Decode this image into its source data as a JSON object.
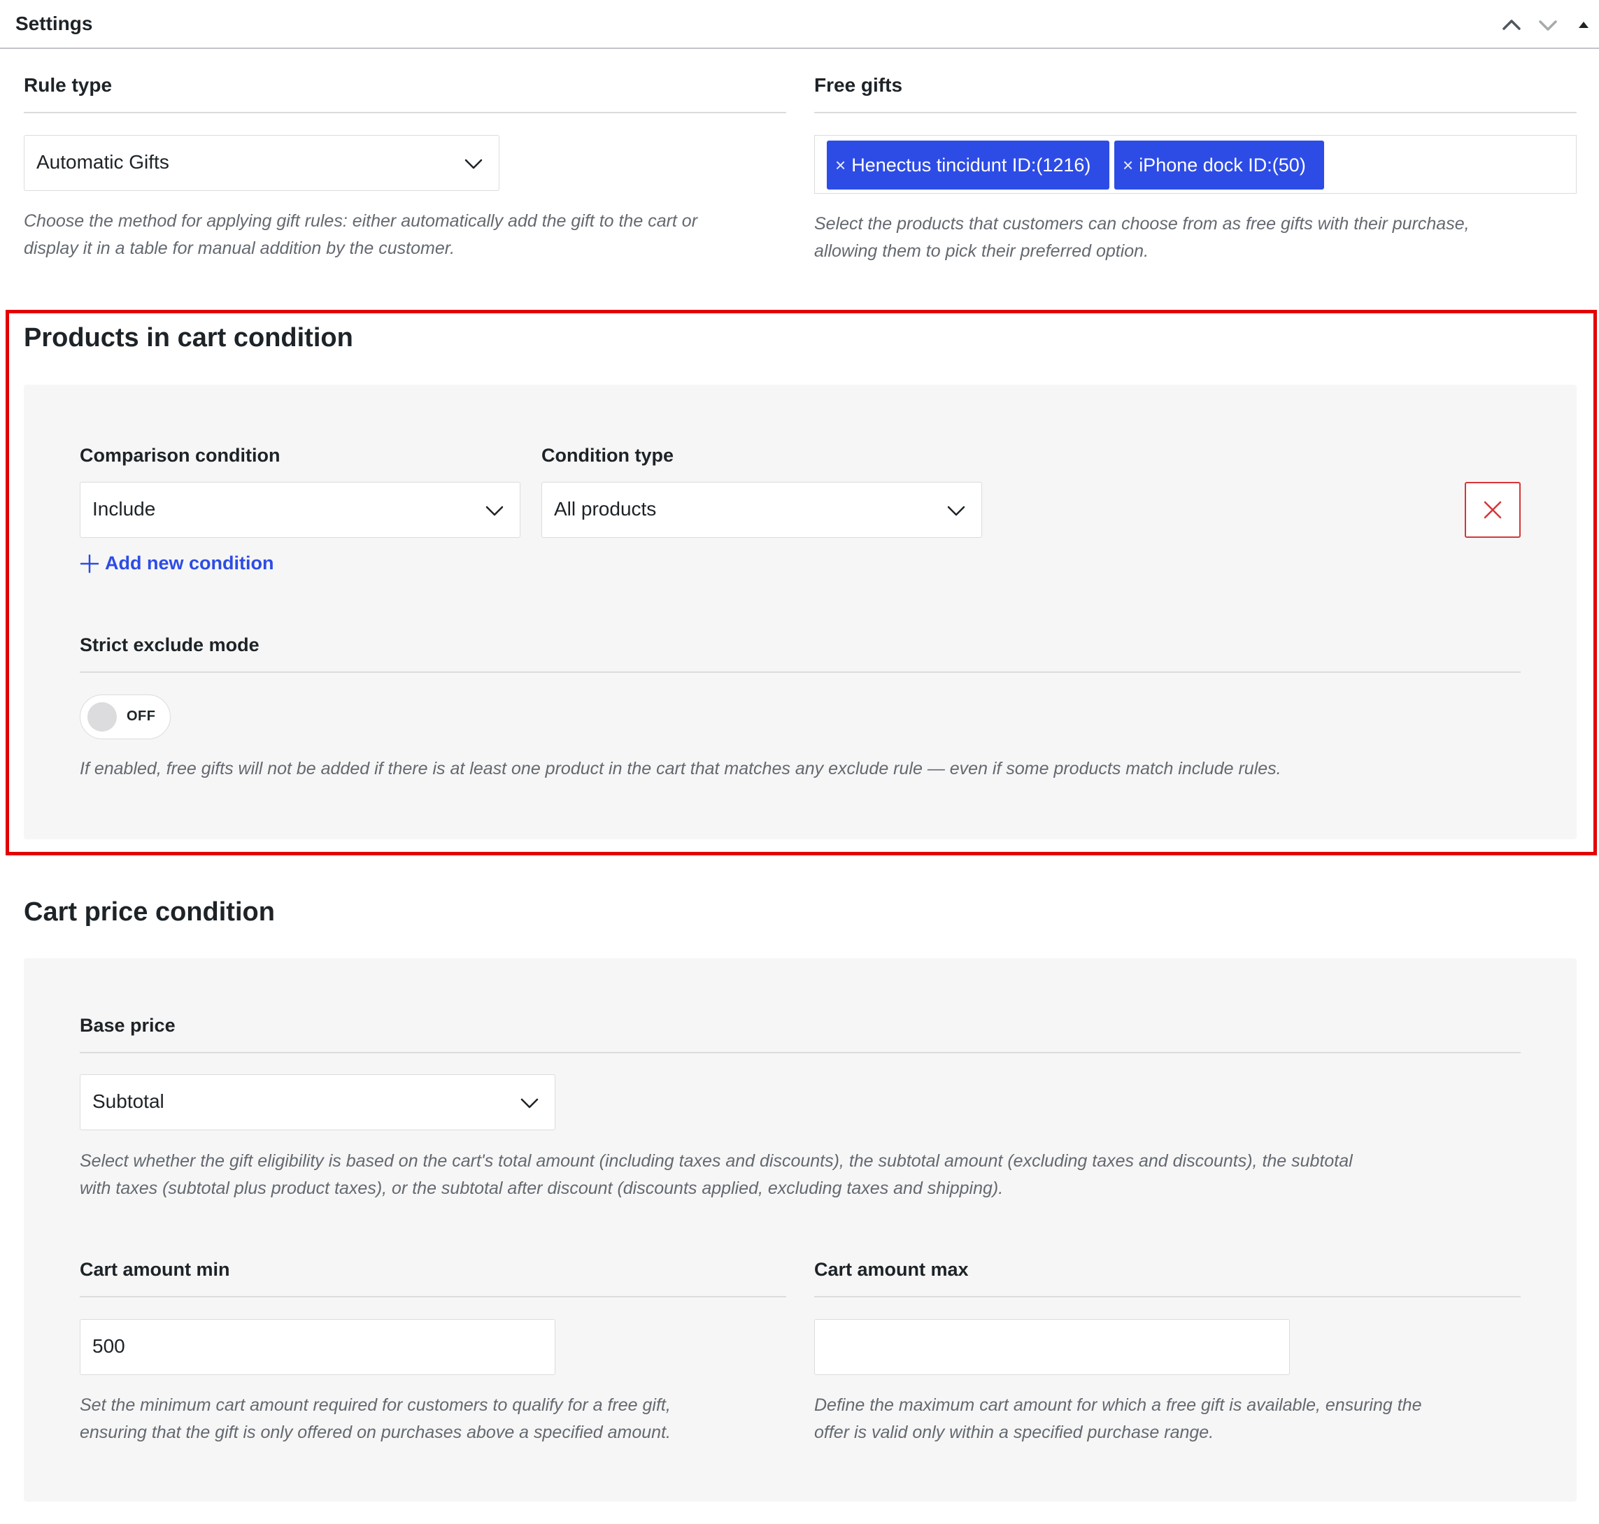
{
  "header": {
    "title": "Settings"
  },
  "rule_type": {
    "label": "Rule type",
    "selected": "Automatic Gifts",
    "description_line1": "Choose the method for applying gift rules: either automatically add the gift to the cart or",
    "description_line2": "display it in a table for manual addition by the customer."
  },
  "free_gifts": {
    "label": "Free gifts",
    "chips": [
      "Henectus tincidunt ID:(1216)",
      "iPhone dock ID:(50)"
    ],
    "remove_glyph": "×",
    "description_line1": "Select the products that customers can choose from as free gifts with their purchase,",
    "description_line2": "allowing them to pick their preferred option."
  },
  "products_condition": {
    "title": "Products in cart condition",
    "comparison_label": "Comparison condition",
    "comparison_value": "Include",
    "condition_type_label": "Condition type",
    "condition_type_value": "All products",
    "add_condition_label": "Add new condition",
    "strict_label": "Strict exclude mode",
    "strict_toggle_text": "OFF",
    "strict_description": "If enabled, free gifts will not be added if there is at least one product in the cart that matches any exclude rule — even if some products match include rules."
  },
  "cart_price_condition": {
    "title": "Cart price condition",
    "base_price_label": "Base price",
    "base_price_value": "Subtotal",
    "base_price_description_line1": "Select whether the gift eligibility is based on the cart's total amount (including taxes and discounts), the subtotal amount (excluding taxes and discounts), the subtotal",
    "base_price_description_line2": "with taxes (subtotal plus product taxes), or the subtotal after discount (discounts applied, excluding taxes and shipping).",
    "min_label": "Cart amount min",
    "min_value": "500",
    "min_description_line1": "Set the minimum cart amount required for customers to qualify for a free gift,",
    "min_description_line2": "ensuring that the gift is only offered on purchases above a specified amount.",
    "max_label": "Cart amount max",
    "max_value": "",
    "max_description_line1": "Define the maximum cart amount for which a free gift is available, ensuring the",
    "max_description_line2": "offer is valid only within a specified purchase range."
  },
  "icons": {
    "move_up": "chevron-up-icon",
    "move_down": "chevron-down-icon",
    "collapse": "triangle-up-icon",
    "select_chevron": "chevron-down-icon",
    "delete": "close-icon",
    "add": "plus-icon"
  },
  "colors": {
    "accent": "#2d4ce6",
    "danger": "#d63638",
    "highlight_border": "#e30000",
    "panel_bg": "#f6f6f6"
  }
}
